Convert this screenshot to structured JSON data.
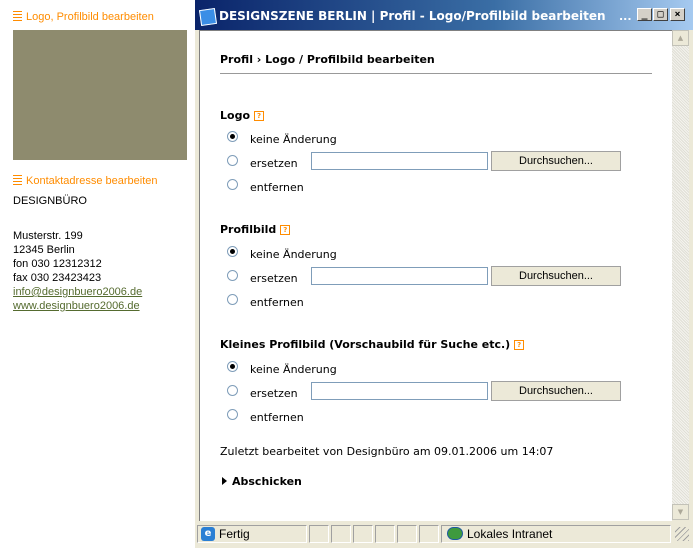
{
  "left_panel": {
    "edit_logo_link": "Logo, Profilbild bearbeiten",
    "edit_contact_link": "Kontaktadresse bearbeiten",
    "company": "DESIGNBÜRO",
    "street": "Musterstr. 199",
    "city": "12345 Berlin",
    "phone": "fon 030 12312312",
    "fax": "fax 030 23423423",
    "email": "info@designbuero2006.de",
    "website": "www.designbuero2006.de"
  },
  "window": {
    "title": "DESIGNSZENE BERLIN | Profil - Logo/Profilbild bearbeiten",
    "title_ellipsis": "...",
    "minimize": "_",
    "maximize": "□",
    "close": "×"
  },
  "form": {
    "breadcrumb": "Profil › Logo / Profilbild bearbeiten",
    "help": "?",
    "sections": [
      {
        "title": "Logo",
        "options": [
          "keine Änderung",
          "ersetzen",
          "entfernen"
        ],
        "selected": 0,
        "browse_label": "Durchsuchen..."
      },
      {
        "title": "Profilbild",
        "options": [
          "keine Änderung",
          "ersetzen",
          "entfernen"
        ],
        "selected": 0,
        "browse_label": "Durchsuchen..."
      },
      {
        "title": "Kleines Profilbild (Vorschaubild für Suche etc.)",
        "options": [
          "keine Änderung",
          "ersetzen",
          "entfernen"
        ],
        "selected": 0,
        "browse_label": "Durchsuchen..."
      }
    ],
    "last_edited": "Zuletzt bearbeitet von Designbüro am 09.01.2006 um 14:07",
    "submit_label": "Abschicken"
  },
  "statusbar": {
    "status": "Fertig",
    "zone": "Lokales Intranet"
  },
  "colors": {
    "accent_orange": "#ff8c00",
    "title_blue": "#0a246a"
  }
}
